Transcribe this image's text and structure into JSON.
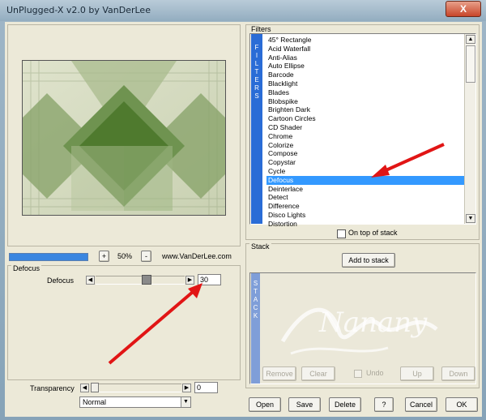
{
  "window": {
    "title": "UnPlugged-X v2.0 by VanDerLee",
    "close_glyph": "X"
  },
  "preview": {
    "zoom_minus": "-",
    "zoom_plus": "+",
    "zoom_value": "50%",
    "website": "www.VanDerLee.com"
  },
  "params": {
    "group_label": "Defocus",
    "defocus_label": "Defocus",
    "defocus_value": "30",
    "transparency_label": "Transparency",
    "transparency_value": "0",
    "blend_mode": "Normal"
  },
  "filters": {
    "group_label": "Filters",
    "side_label": [
      "F",
      "I",
      "L",
      "T",
      "E",
      "R",
      "S"
    ],
    "items": [
      "45° Rectangle",
      "Acid Waterfall",
      "Anti-Alias",
      "Auto Ellipse",
      "Barcode",
      "Blacklight",
      "Blades",
      "Blobspike",
      "Brighten Dark",
      "Cartoon Circles",
      "CD Shader",
      "Chrome",
      "Colorize",
      "Compose",
      "Copystar",
      "Cycle",
      "Defocus",
      "Deinterlace",
      "Detect",
      "Difference",
      "Disco Lights",
      "Distortion"
    ],
    "selected_index": 16,
    "on_top_label": "On top of stack"
  },
  "stack": {
    "group_label": "Stack",
    "add_button": "Add to stack",
    "side_label": [
      "S",
      "T",
      "A",
      "C",
      "K"
    ],
    "remove": "Remove",
    "clear": "Clear",
    "undo": "Undo",
    "up": "Up",
    "down": "Down",
    "watermark": "Nanany"
  },
  "footer": {
    "open": "Open",
    "save": "Save",
    "delete": "Delete",
    "help": "?",
    "cancel": "Cancel",
    "ok": "OK"
  },
  "colors": {
    "selection": "#3399ff",
    "filter_bar": "#2a6cd6",
    "stack_bar": "#7f9ed8",
    "arrow": "#e11515",
    "progress": "#3a86e0"
  }
}
